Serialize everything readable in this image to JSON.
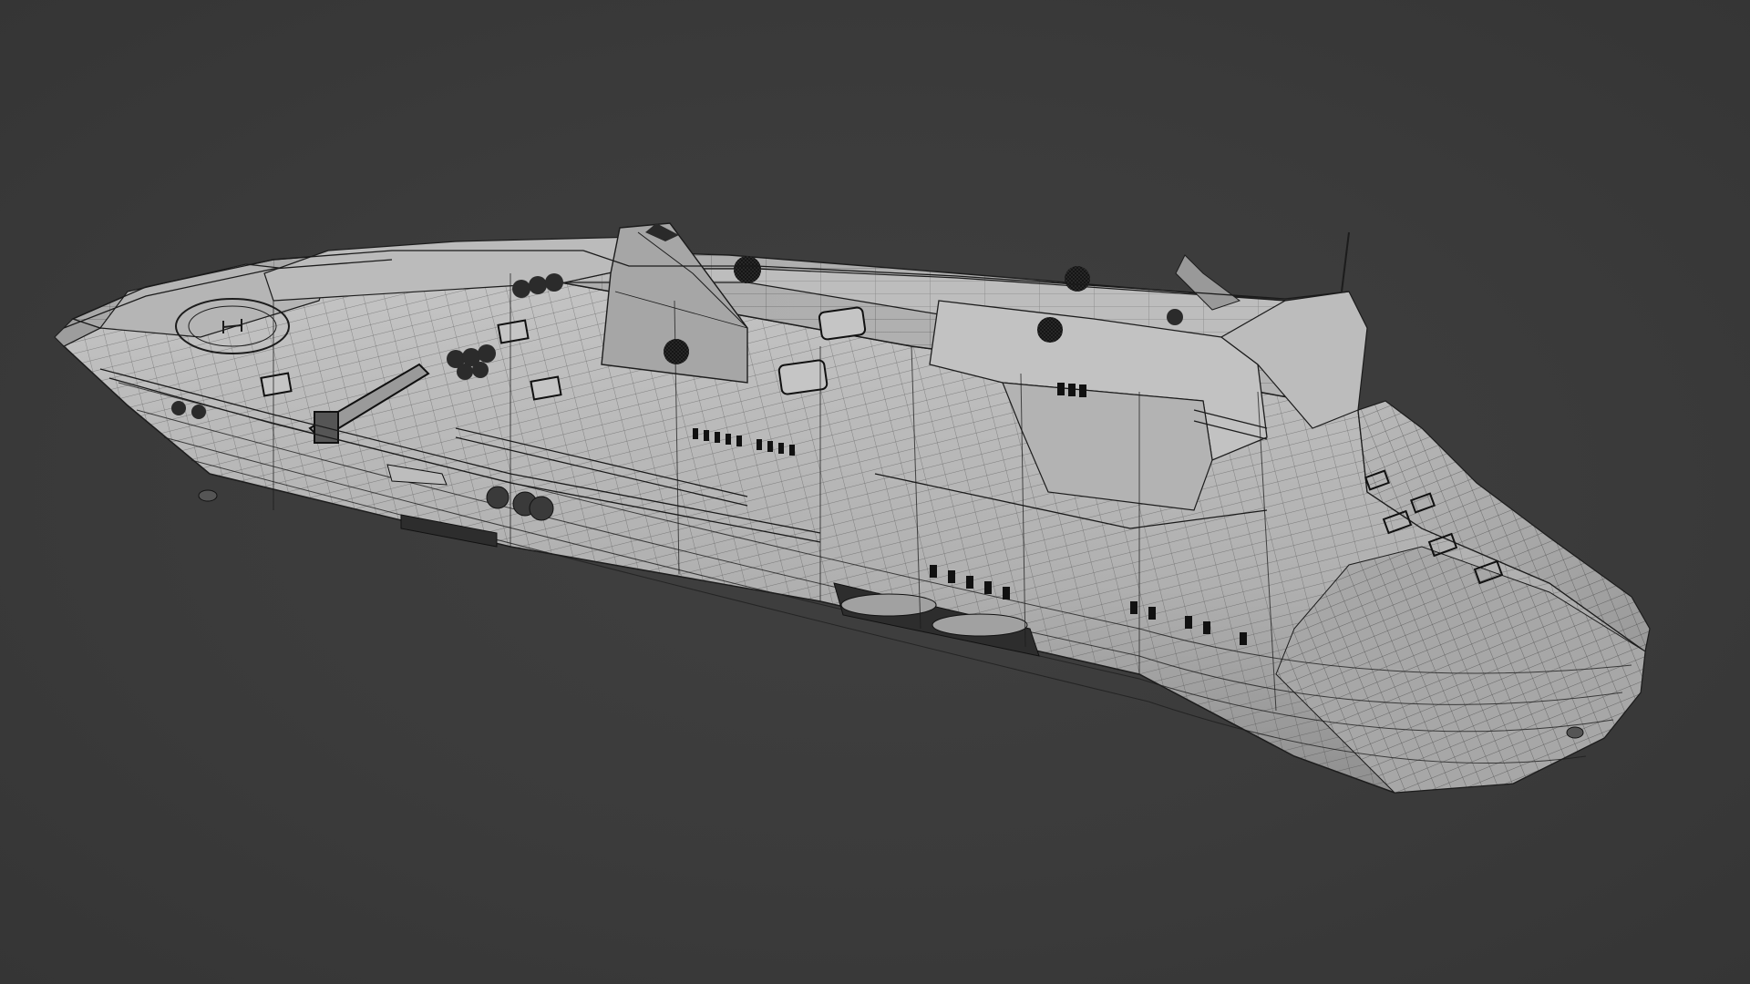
{
  "scene": {
    "subject": "ship-hull-wireframe",
    "background_color": "#3c3c3c",
    "hull_color": "#b8b8b8",
    "deck_color": "#a9a9a9",
    "wire_color": "#1e1e1e",
    "accent_dark": "#2a2a2a",
    "window_color": "#111111"
  }
}
